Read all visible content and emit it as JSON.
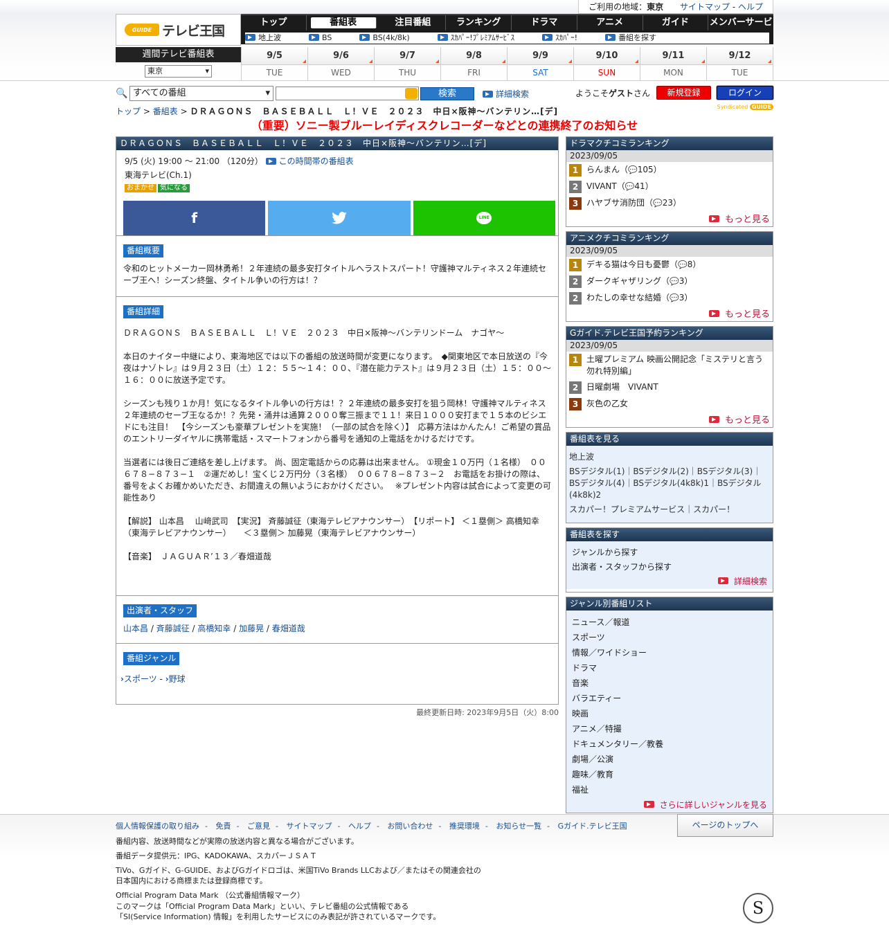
{
  "region": {
    "label": "ご利用の地域：",
    "value": "東京",
    "sitemap": "サイトマップ",
    "sep": "-",
    "help": "ヘルプ"
  },
  "logo": {
    "badge": "GUIDE",
    "text": "テレビ王国"
  },
  "nav": {
    "items": [
      "トップ",
      "番組表",
      "注目番組",
      "ランキング",
      "ドラマ",
      "アニメ",
      "ガイド",
      "メンバーサービス"
    ],
    "sub": [
      "地上波",
      "BS",
      "BS(4k/8k)",
      "ｽｶﾊﾟｰ!ﾌﾟﾚﾐｱﾑｻｰﾋﾞｽ",
      "ｽｶﾊﾟｰ!",
      "番組を探す"
    ]
  },
  "weekly": {
    "title": "週間テレビ番組表",
    "area": "東京"
  },
  "dates": [
    {
      "d": "9/5",
      "w": "TUE"
    },
    {
      "d": "9/6",
      "w": "WED"
    },
    {
      "d": "9/7",
      "w": "THU"
    },
    {
      "d": "9/8",
      "w": "FRI"
    },
    {
      "d": "9/9",
      "w": "SAT"
    },
    {
      "d": "9/10",
      "w": "SUN"
    },
    {
      "d": "9/11",
      "w": "MON"
    },
    {
      "d": "9/12",
      "w": "TUE"
    }
  ],
  "search": {
    "category": "すべての番組",
    "button": "検索",
    "advanced": "詳細検索",
    "welcome_pre": "ようこそ",
    "guest": "ゲスト",
    "welcome_post": "さん",
    "register": "新規登録",
    "login": "ログイン"
  },
  "crumb": {
    "top": "トップ",
    "sep": ">",
    "guide": "番組表",
    "title": "ＤＲＡＧＯＮＳ　ＢＡＳＥＢＡＬＬ　Ｌ！ＶＥ　２０２３　中日×阪神〜バンテリン…[デ]"
  },
  "syndicated": "Syndicated",
  "notice": "（重要）ソニー製ブルーレイディスクレコーダーなどとの連携終了のお知らせ",
  "program": {
    "header": "ＤＲＡＧＯＮＳ　ＢＡＳＥＢＡＬＬ　Ｌ！ＶＥ　２０２３　中日×阪神〜バンテリン…[デ]",
    "time": "9/5 (火) 19:00 〜 21:00 （120分）",
    "timeslot_link": "この時間帯の番組表",
    "channel": "東海テレビ(Ch.1)",
    "badges": [
      "おまかせ",
      "気になる"
    ],
    "social": {
      "facebook": "f",
      "twitter": "twitter-bird",
      "line": "LINE"
    },
    "summary_label": "番組概要",
    "summary": "令和のヒットメーカー岡林勇希！２年連続の最多安打タイトルへラストスパート！守護神マルティネス２年連続セーブ王へ！シーズン終盤、タイトル争いの行方は！？",
    "detail_label": "番組詳細",
    "detail": [
      "ＤＲＡＧＯＮＳ　ＢＡＳＥＢＡＬＬ　Ｌ！ＶＥ　２０２３　中日×阪神〜バンテリンドーム　ナゴヤ〜",
      "本日のナイター中継により、東海地区では以下の番組の放送時間が変更になります。　◆関東地区で本日放送の『今夜はナゾトレ』は９月２３日（土）１２：５５〜１４：００、『潜在能力テスト』は９月２３日（土）１５：００〜１６：００に放送予定です。",
      "シーズンも残り１か月！気になるタイトル争いの行方は！？２年連続の最多安打を狙う岡林！守護神マルティネス２年連続のセーブ王なるか！？先発・涌井は通算２０００奪三振まで１１！来日１０００安打まで１５本のビシエドにも注目！　【今シーズンも豪華プレゼントを実施！（一部の試合を除く）】　応募方法はかんたん！ご希望の賞品のエントリーダイヤルに携帯電話・スマートフォンから番号を通知の上電話をかけるだけです。",
      "当選者には後日ご連絡を差し上げます。 尚、固定電話からの応募は出来ません。 ①現金１０万円（１名様）　００６７８−８７３−１　②運だめし！宝くじ２万円分（３名様）　００６７８−８７３−２　お電話をお掛けの際は、番号をよくお確かめいただき、お間違えの無いようにおかけください。　 ※プレゼント内容は試合によって変更の可能性あり",
      "【解説】 山本昌　 山﨑武司　【実況】 斉藤誠征（東海テレビアナウンサー）　【リポート】 ＜１塁側＞ 高橋知幸（東海テレビアナウンサー）　　＜３塁側＞ 加藤晃（東海テレビアナウンサー）",
      "【音楽】　ＪＡＧＵＡＲ’１３／春畑道哉"
    ],
    "cast_label": "出演者・スタッフ",
    "cast": [
      "山本昌",
      "斉藤誠征",
      "高橋知幸",
      "加藤晃",
      "春畑道哉"
    ],
    "cast_sep": " / ",
    "genre_label": "番組ジャンル",
    "genres": [
      "スポーツ",
      "野球"
    ],
    "genre_sep": " - ",
    "updated": "最終更新日時: 2023年9月5日（火）8:00"
  },
  "drama_rank": {
    "title": "ドラマクチコミランキング",
    "date": "2023/09/05",
    "items": [
      {
        "no": "1",
        "name": "らんまん（",
        "count": "105",
        "close": "）"
      },
      {
        "no": "2",
        "name": "VIVANT（",
        "count": "41",
        "close": "）"
      },
      {
        "no": "3",
        "name": "ハヤブサ消防団（",
        "count": "23",
        "close": "）"
      }
    ],
    "more": "もっと見る"
  },
  "anime_rank": {
    "title": "アニメクチコミランキング",
    "date": "2023/09/05",
    "items": [
      {
        "no": "1",
        "name": "デキる猫は今日も憂鬱（",
        "count": "8",
        "close": "）"
      },
      {
        "no": "2",
        "name": "ダークギャザリング（",
        "count": "3",
        "close": "）"
      },
      {
        "no": "2",
        "name": "わたしの幸せな結婚（",
        "count": "3",
        "close": "）"
      }
    ],
    "more": "もっと見る"
  },
  "reserve_rank": {
    "title": "Gガイド.テレビ王国予約ランキング",
    "date": "2023/09/05",
    "items": [
      {
        "no": "1",
        "name": "土曜プレミアム 映画公開記念「ミステリと言う勿れ特別編」"
      },
      {
        "no": "2",
        "name": "日曜劇場　VIVANT"
      },
      {
        "no": "3",
        "name": "灰色の乙女"
      }
    ],
    "more": "もっと見る"
  },
  "guide_box": {
    "title": "番組表を見る",
    "lines": [
      "地上波",
      "BSデジタル(1)｜BSデジタル(2)｜BSデジタル(3)｜BSデジタル(4)｜BSデジタル(4k8k)1｜BSデジタル(4k8k)2",
      "スカパー！プレミアムサービス｜スカパー！"
    ]
  },
  "find_box": {
    "title": "番組表を探す",
    "items": [
      "ジャンルから探す",
      "出演者・スタッフから探す"
    ],
    "more": "詳細検索"
  },
  "genre_box": {
    "title": "ジャンル別番組リスト",
    "items": [
      "ニュース／報道",
      "スポーツ",
      "情報／ワイドショー",
      "ドラマ",
      "音楽",
      "バラエティー",
      "映画",
      "アニメ／特撮",
      "ドキュメンタリー／教養",
      "劇場／公演",
      "趣味／教育",
      "福祉"
    ],
    "more": "さらに詳しいジャンルを見る"
  },
  "footer": {
    "links": [
      "個人情報保護の取り組み",
      "免責",
      "ご意見",
      "サイトマップ",
      "ヘルプ",
      "お問い合わせ",
      "推奨環境",
      "お知らせ一覧",
      "Gガイド.テレビ王国"
    ],
    "link_sep": "-",
    "totop": "ページのトップへ",
    "note1": "番組内容、放送時間などが実際の放送内容と異なる場合がございます。",
    "note2": "番組データ提供元：IPG、KADOKAWA、スカパーＪＳＡＴ",
    "note3": "TiVo、Gガイド、G-GUIDE、およびGガイドロゴは、米国TiVo Brands LLCおよび／またはその関連会社の日本国内における商標または登録商標です。",
    "note4": "Official Program Data Mark （公式番組情報マーク）",
    "note5": "このマークは「Official Program Data Mark」といい、テレビ番組の公式情報である「SI(Service Information) 情報」を利用したサービスにのみ表記が許されているマークです。",
    "seal": "S"
  }
}
